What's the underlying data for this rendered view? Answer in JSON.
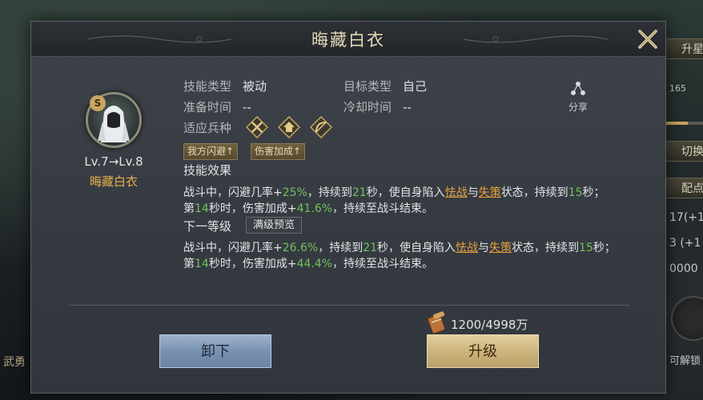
{
  "background": {
    "left_label": "武勇",
    "side_panel": {
      "btn1": "升星",
      "progress_text": "165",
      "progress_fraction": 0.6,
      "btn2": "切换",
      "btn3": "配点",
      "stat1": "17(+1",
      "stat2": "3 (+1",
      "stat3": "0000",
      "unlock_label": "可解锁"
    }
  },
  "dialog": {
    "title": "晦藏白衣",
    "close_icon": "close-x-icon"
  },
  "skill": {
    "badge": "S",
    "level_text": "Lv.7→Lv.8",
    "name": "晦藏白衣",
    "type_label": "技能类型",
    "type_value": "被动",
    "target_label": "目标类型",
    "target_value": "自己",
    "prep_label": "准备时间",
    "prep_value": "--",
    "cooldown_label": "冷却时间",
    "cooldown_value": "--",
    "units_label": "适应兵种",
    "units": [
      "cavalry-icon",
      "shield-icon",
      "bow-icon"
    ],
    "share_label": "分享",
    "tags": [
      "我方闪避↑",
      "伤害加成↑"
    ],
    "effect_title": "技能效果",
    "effect": {
      "p1": "战斗中，闪避几率+",
      "v1": "25%",
      "p2": "，持续到",
      "v2": "21",
      "p3": "秒，使自身陷入",
      "l1": "怯战",
      "p4": "与",
      "l2": "失策",
      "p5": "状态，持续到",
      "v3": "15",
      "p6": "秒；第",
      "v4": "14",
      "p7": "秒时，伤害加成+",
      "v5": "41.6%",
      "p8": "，持续至战斗结束。"
    },
    "next_title": "下一等级",
    "max_preview_label": "满级预览",
    "next": {
      "p1": "战斗中，闪避几率+",
      "v1": "26.6%",
      "p2": "，持续到",
      "v2": "21",
      "p3": "秒，使自身陷入",
      "l1": "怯战",
      "p4": "与",
      "l2": "失策",
      "p5": "状态，持续到",
      "v3": "15",
      "p6": "秒；第",
      "v4": "14",
      "p7": "秒时，伤害加成+",
      "v5": "44.4%",
      "p8": "，持续至战斗结束。"
    }
  },
  "cost": {
    "icon": "scroll-icon",
    "text": "1200/4998万"
  },
  "buttons": {
    "unequip": "卸下",
    "upgrade": "升级"
  }
}
